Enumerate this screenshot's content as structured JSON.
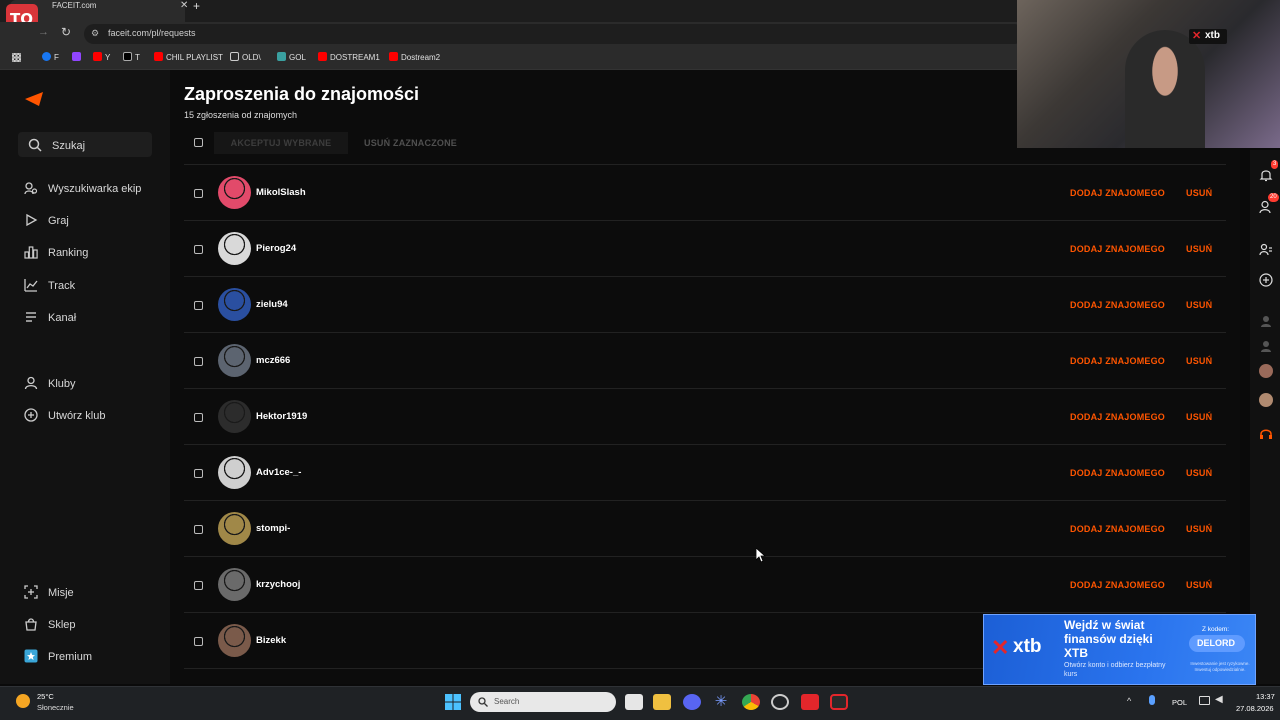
{
  "browser": {
    "tab_title": "FACEIT.com",
    "close_glyph": "✕",
    "new_tab_glyph": "+",
    "url": "faceit.com/pl/requests",
    "bookmarks": [
      {
        "label": "F",
        "color": "#1877f2"
      },
      {
        "label": "",
        "color": "#9146ff"
      },
      {
        "label": "Y",
        "color": "#ff0000"
      },
      {
        "label": "T",
        "color": "#ffffff"
      },
      {
        "label": "CHIL PLAYLIST",
        "color": "#ff0000"
      },
      {
        "label": "OLD\\",
        "color": "#cccccc"
      },
      {
        "label": "GOL",
        "color": "#3aa0a0"
      },
      {
        "label": "DOSTREAM1",
        "color": "#ff0000"
      },
      {
        "label": "Dostream2",
        "color": "#ff0000"
      }
    ]
  },
  "sidebar": {
    "search_label": "Szukaj",
    "items": [
      {
        "label": "Wyszukiwarka ekip",
        "icon": "team-search-icon"
      },
      {
        "label": "Graj",
        "icon": "play-icon"
      },
      {
        "label": "Ranking",
        "icon": "ranking-icon"
      },
      {
        "label": "Track",
        "icon": "track-icon"
      },
      {
        "label": "Kanał",
        "icon": "feed-icon"
      },
      {
        "label": "Kluby",
        "icon": "clubs-icon"
      },
      {
        "label": "Utwórz klub",
        "icon": "create-club-icon"
      },
      {
        "label": "Misje",
        "icon": "missions-icon"
      },
      {
        "label": "Sklep",
        "icon": "shop-icon"
      },
      {
        "label": "Premium",
        "icon": "premium-icon"
      }
    ]
  },
  "main": {
    "title": "Zaproszenia do znajomości",
    "subtitle": "15 zgłoszenia od znajomych",
    "accept_selected": "AKCEPTUJ WYBRANE",
    "delete_selected": "USUŃ ZAZNACZONE",
    "add_label": "DODAJ ZNAJOMEGO",
    "remove_label": "USUŃ",
    "requests": [
      {
        "name": "MikolSlash",
        "avatar_color": "#e24a6a"
      },
      {
        "name": "Pierog24",
        "avatar_color": "#d9d9d9"
      },
      {
        "name": "zielu94",
        "avatar_color": "#2a4fa0"
      },
      {
        "name": "mcz666",
        "avatar_color": "#5c6470"
      },
      {
        "name": "Hektor1919",
        "avatar_color": "#2c2c2c"
      },
      {
        "name": "Adv1ce-_-",
        "avatar_color": "#cfcfcf"
      },
      {
        "name": "stompi-",
        "avatar_color": "#a08848"
      },
      {
        "name": "krzychooj",
        "avatar_color": "#6a6a6a"
      },
      {
        "name": "Bizekk",
        "avatar_color": "#7a5a4a"
      }
    ]
  },
  "rail": {
    "notif_badge": "3",
    "friends_badge": "20"
  },
  "overlay": {
    "brand": "xtb",
    "logo_text": "ТО"
  },
  "ad": {
    "brand": "xtb",
    "headline": "Wejdź w świat finansów dzięki XTB",
    "body": "Otwórz konto i odbierz bezpłatny kurs",
    "code_label": "Z kodem:",
    "code": "DELORD",
    "disclaimer": "Inwestowanie jest ryzykowne. Inwestuj odpowiedzialnie."
  },
  "taskbar": {
    "weather_temp": "25°C",
    "weather_desc": "Słonecznie",
    "search_label": "Search",
    "language": "POL",
    "time": "13:37",
    "date": "27.08.2026"
  }
}
